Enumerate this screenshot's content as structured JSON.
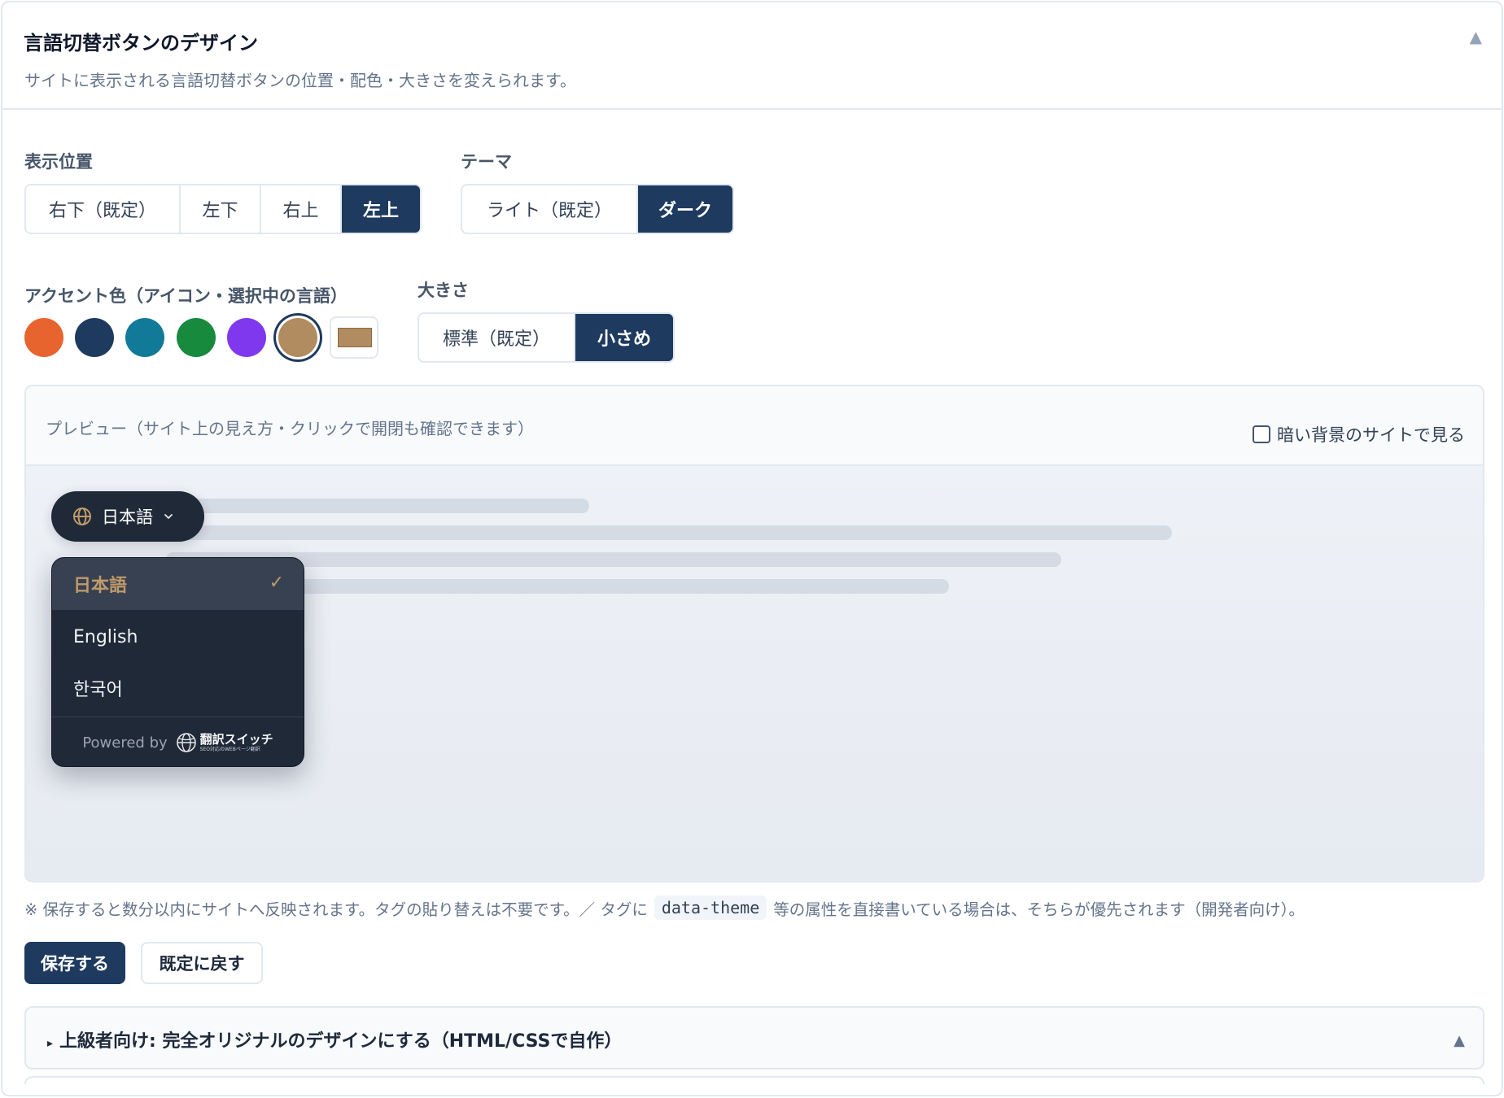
{
  "header": {
    "title": "言語切替ボタンのデザイン",
    "subtitle": "サイトに表示される言語切替ボタンの位置・配色・大きさを変えられます。",
    "collapse_icon": "▲"
  },
  "position": {
    "label": "表示位置",
    "options": [
      "右下（既定）",
      "左下",
      "右上",
      "左上"
    ],
    "selected": "左上"
  },
  "theme": {
    "label": "テーマ",
    "options": [
      "ライト（既定）",
      "ダーク"
    ],
    "selected": "ダーク"
  },
  "accent": {
    "label": "アクセント色（アイコン・選択中の言語）",
    "colors": [
      "#e8642e",
      "#1e3a5f",
      "#117a99",
      "#178a3e",
      "#8038ee",
      "#b08c60"
    ],
    "selected": "#b08c60",
    "custom_color": "#b08c60"
  },
  "size": {
    "label": "大きさ",
    "options": [
      "標準（既定）",
      "小さめ"
    ],
    "selected": "小さめ"
  },
  "preview": {
    "title": "プレビュー（サイト上の見え方・クリックで開閉も確認できます）",
    "dark_bg_label": "暗い背景のサイトで見る",
    "dark_bg_checked": false,
    "button_label": "日本語",
    "dropdown": {
      "items": [
        "日本語",
        "English",
        "한국어"
      ],
      "selected": "日本語",
      "check_icon": "✓",
      "powered_by": "Powered by",
      "brand_name": "翻訳スイッチ",
      "brand_tagline": "SEO対応のWEBページ翻訳"
    }
  },
  "note": {
    "before_code": "※ 保存すると数分以内にサイトへ反映されます。タグの貼り替えは不要です。／ タグに",
    "code": "data-theme",
    "after_code": "等の属性を直接書いている場合は、そちらが優先されます（開発者向け）。"
  },
  "actions": {
    "save_label": "保存する",
    "reset_label": "既定に戻す"
  },
  "advanced": {
    "marker": "▸",
    "title": "上級者向け: 完全オリジナルのデザインにする（HTML/CSSで自作）",
    "arrow": "▲"
  }
}
